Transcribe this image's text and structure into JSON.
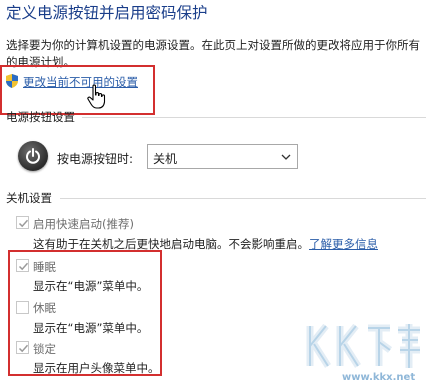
{
  "page": {
    "title": "定义电源按钮并启用密码保护",
    "description": "选择要为你的计算机设置的电源设置。在此页上对设置所做的更改将应用于你所有的电源计划。",
    "change_link": "更改当前不可用的设置"
  },
  "power_button_section": {
    "title": "电源按钮设置",
    "label": "按电源按钮时:",
    "selected": "关机"
  },
  "shutdown_section": {
    "title": "关机设置",
    "options": [
      {
        "label": "启用快速启动(推荐)",
        "desc": "这有助于在关机之后更快地启动电脑。不会影响重启。",
        "link": "了解更多信息",
        "checked": true,
        "enabled": false
      },
      {
        "label": "睡眠",
        "desc": "显示在“电源”菜单中。",
        "checked": true,
        "enabled": false
      },
      {
        "label": "休眠",
        "desc": "显示在“电源”菜单中。",
        "checked": false,
        "enabled": false
      },
      {
        "label": "锁定",
        "desc": "显示在用户头像菜单中。",
        "checked": true,
        "enabled": false
      }
    ]
  },
  "watermark": {
    "url": "www.kkx.net"
  },
  "colors": {
    "title": "#1a3e8a",
    "link": "#2a5ca8",
    "highlight_box": "#d32f2f",
    "disabled_text": "#6e6e6e"
  }
}
